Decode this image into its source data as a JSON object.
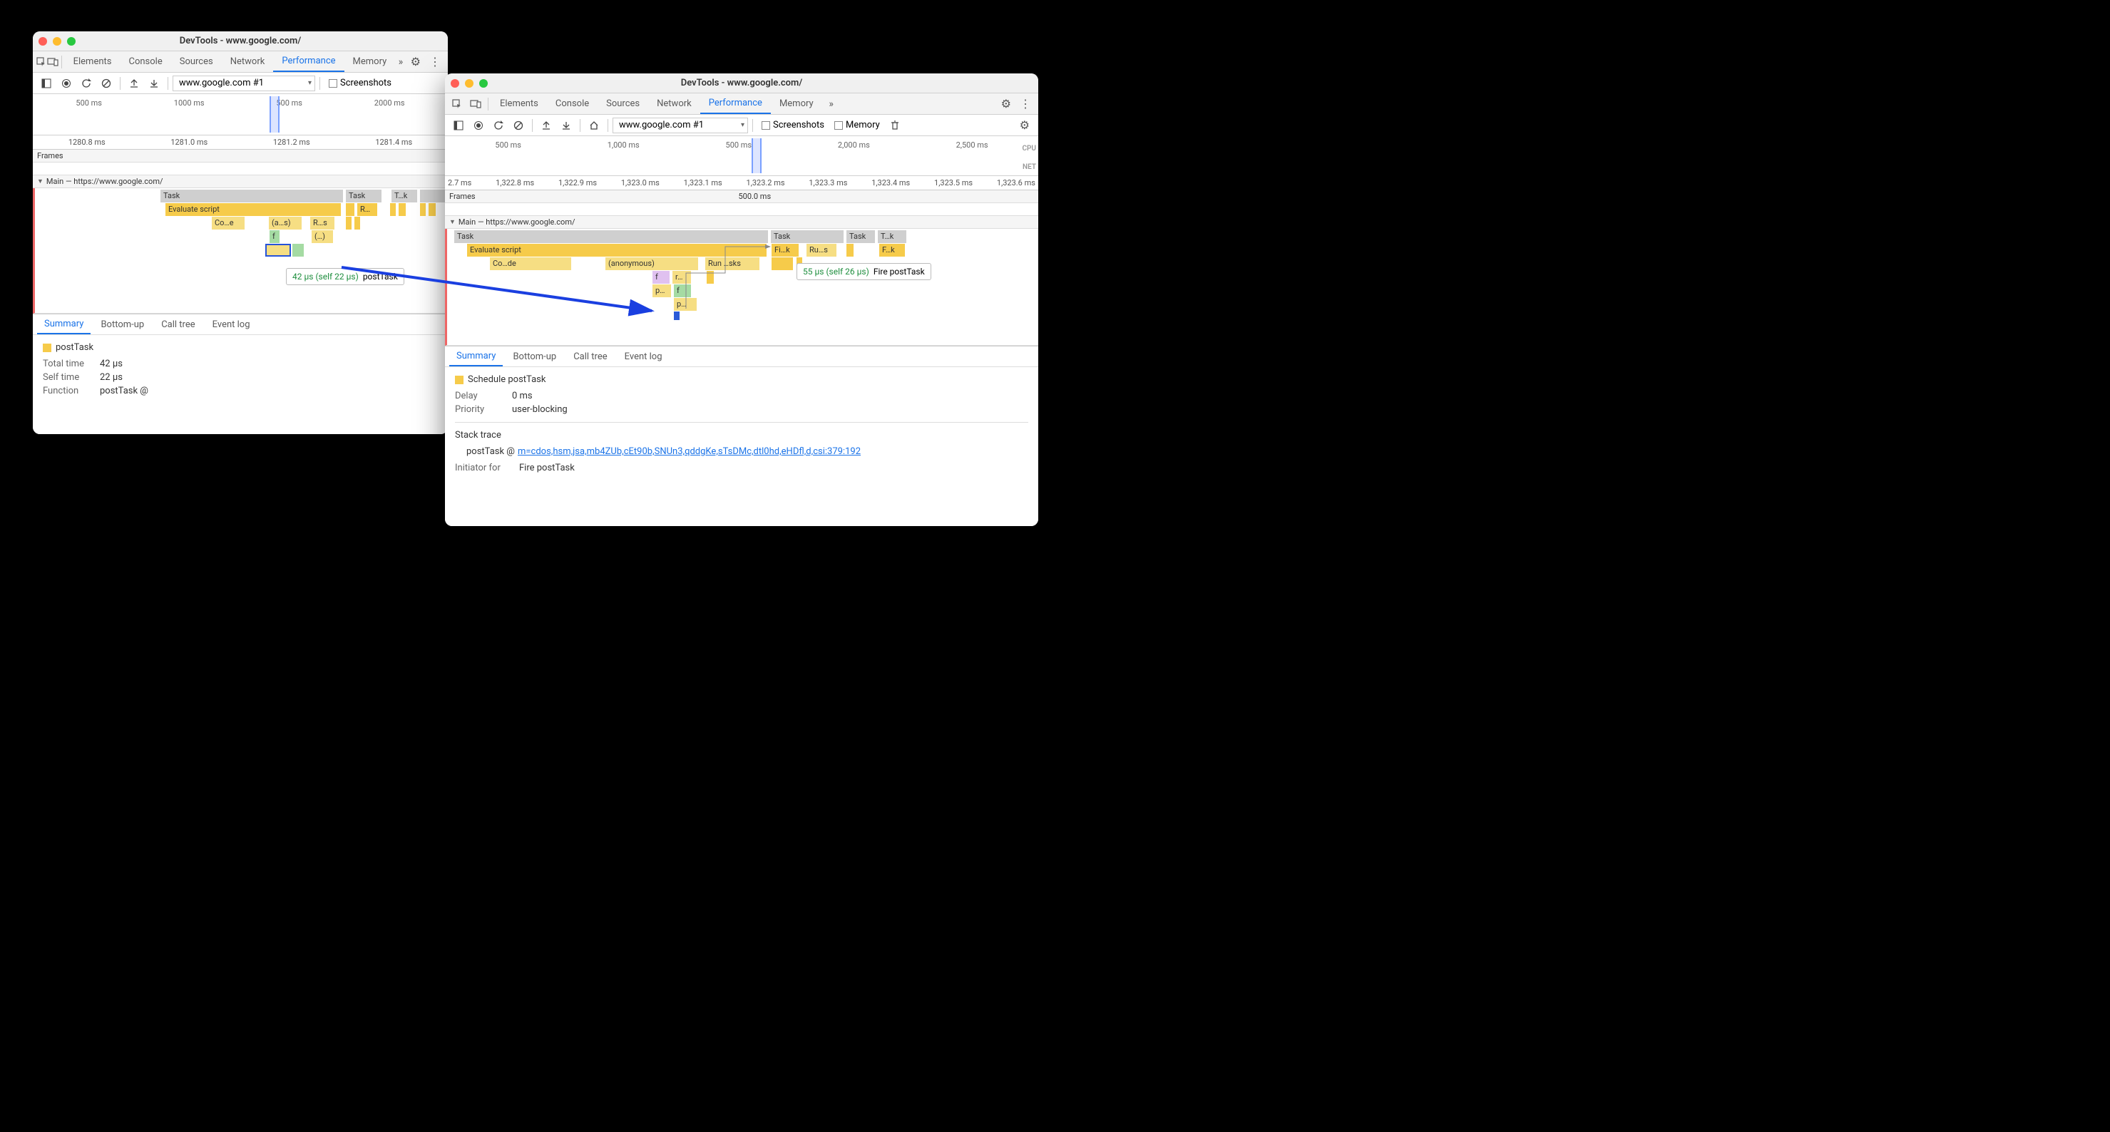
{
  "window1": {
    "title": "DevTools - www.google.com/",
    "tabs": [
      "Elements",
      "Console",
      "Sources",
      "Network",
      "Performance",
      "Memory"
    ],
    "active_tab": "Performance",
    "rec_target": "www.google.com #1",
    "opt_screenshots": "Screenshots",
    "overview_ticks": [
      "500 ms",
      "1000 ms",
      "500 ms",
      "2000 ms"
    ],
    "ruler": [
      "1280.8 ms",
      "1281.0 ms",
      "1281.2 ms",
      "1281.4 ms"
    ],
    "frames_label": "Frames",
    "main_label": "Main — https://www.google.com/",
    "tasks": [
      "Task",
      "Task",
      "T…k"
    ],
    "evaluate": "Evaluate script",
    "short_fn": [
      "Co…e",
      "(a…s)",
      "R…s",
      "f",
      "(…)",
      "R…"
    ],
    "tooltip_timing": "42 µs (self 22 µs)",
    "tooltip_name": "postTask",
    "detail_tabs": [
      "Summary",
      "Bottom-up",
      "Call tree",
      "Event log"
    ],
    "detail_title": "postTask",
    "rows": {
      "total_time_label": "Total time",
      "total_time_value": "42 µs",
      "self_time_label": "Self time",
      "self_time_value": "22 µs",
      "function_label": "Function",
      "function_value": "postTask @"
    }
  },
  "window2": {
    "title": "DevTools - www.google.com/",
    "tabs": [
      "Elements",
      "Console",
      "Sources",
      "Network",
      "Performance",
      "Memory"
    ],
    "active_tab": "Performance",
    "rec_target": "www.google.com #1",
    "opt_screenshots": "Screenshots",
    "opt_memory": "Memory",
    "overview_ticks": [
      "500 ms",
      "1,000 ms",
      "500 ms",
      "2,000 ms",
      "2,500 ms"
    ],
    "side_cpu": "CPU",
    "side_net": "NET",
    "ruler": [
      "2.7 ms",
      "1,322.8 ms",
      "1,322.9 ms",
      "1,323.0 ms",
      "1,323.1 ms",
      "1,323.2 ms",
      "1,323.3 ms",
      "1,323.4 ms",
      "1,323.5 ms",
      "1,323.6 ms"
    ],
    "frames_label": "Frames",
    "frames_value": "500.0 ms",
    "main_label": "Main — https://www.google.com/",
    "tasks": [
      "Task",
      "Task",
      "Task",
      "T…k"
    ],
    "evaluate": "Evaluate script",
    "fi_k": "Fi…k",
    "ru_s": "Ru…s",
    "f_k": "F…k",
    "anonymous": "(anonymous)",
    "code": "Co…de",
    "run_sks": "Run …sks",
    "small_fn": [
      "f",
      "r…",
      "p…",
      "f",
      "p…"
    ],
    "tooltip_timing": "55 µs (self 26 µs)",
    "tooltip_name": "Fire postTask",
    "detail_tabs": [
      "Summary",
      "Bottom-up",
      "Call tree",
      "Event log"
    ],
    "detail_title": "Schedule postTask",
    "rows": {
      "delay_label": "Delay",
      "delay_value": "0 ms",
      "priority_label": "Priority",
      "priority_value": "user-blocking"
    },
    "stack_trace_label": "Stack trace",
    "stack_trace_fn": "postTask @",
    "stack_trace_link": "m=cdos,hsm,jsa,mb4ZUb,cEt90b,SNUn3,qddgKe,sTsDMc,dtl0hd,eHDfl,d,csi:379:192",
    "initiator_label": "Initiator for",
    "initiator_value": "Fire postTask"
  }
}
